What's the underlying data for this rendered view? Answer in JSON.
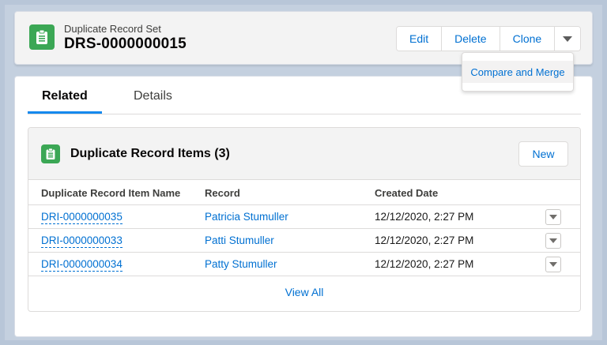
{
  "colors": {
    "accent": "#0070d2",
    "object_icon": "#3ba755",
    "tab_underline": "#1589ee"
  },
  "header": {
    "icon": "clipboard-icon",
    "subtitle": "Duplicate Record Set",
    "title": "DRS-0000000015",
    "buttons": {
      "edit": "Edit",
      "delete": "Delete",
      "clone": "Clone"
    },
    "more_icon": "chevron-down-icon"
  },
  "menu": {
    "items": [
      "Compare and Merge"
    ]
  },
  "tabs": {
    "related": "Related",
    "details": "Details"
  },
  "related_list": {
    "icon": "clipboard-icon",
    "title": "Duplicate Record Items (3)",
    "new_label": "New",
    "columns": [
      "Duplicate Record Item Name",
      "Record",
      "Created Date"
    ],
    "rows": [
      {
        "name": "DRI-0000000035",
        "record": "Patricia Stumuller",
        "created": "12/12/2020, 2:27 PM"
      },
      {
        "name": "DRI-0000000033",
        "record": "Patti Stumuller",
        "created": "12/12/2020, 2:27 PM"
      },
      {
        "name": "DRI-0000000034",
        "record": "Patty Stumuller",
        "created": "12/12/2020, 2:27 PM"
      }
    ],
    "view_all": "View All"
  }
}
